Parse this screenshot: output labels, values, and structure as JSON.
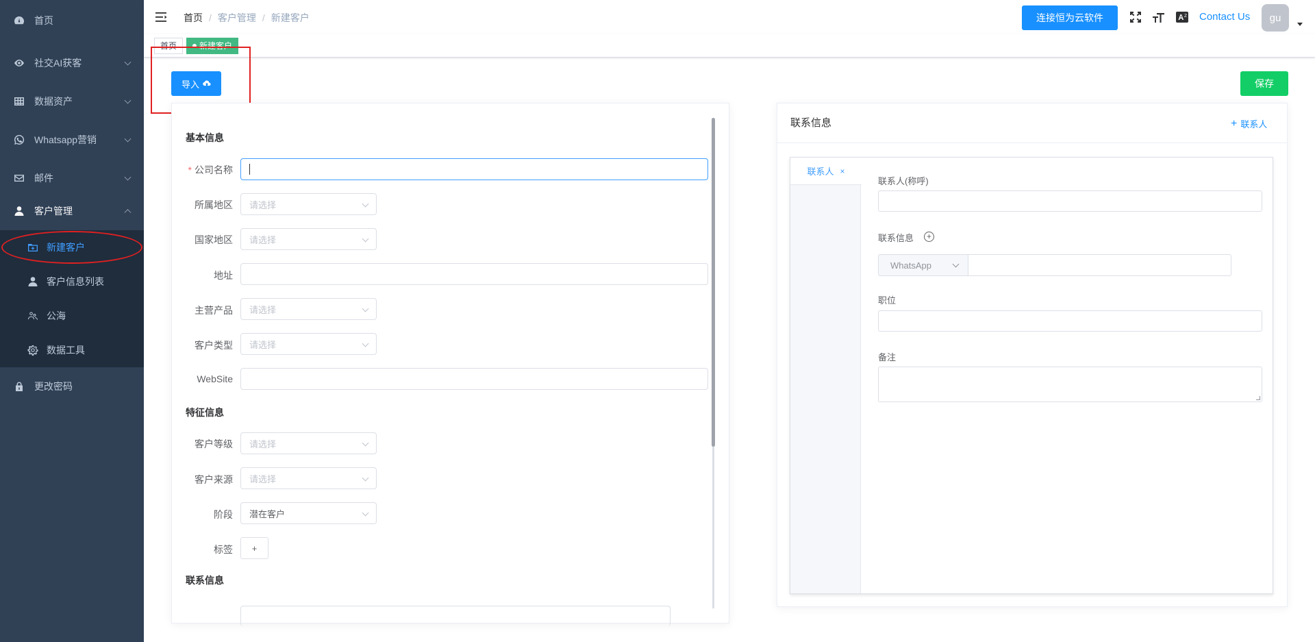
{
  "sidebar": {
    "items": [
      {
        "label": "首页",
        "icon": "dashboard-icon"
      },
      {
        "label": "社交AI获客",
        "icon": "eye-icon"
      },
      {
        "label": "数据资产",
        "icon": "table-icon"
      },
      {
        "label": "Whatsapp营销",
        "icon": "whatsapp-icon"
      },
      {
        "label": "邮件",
        "icon": "mail-icon"
      },
      {
        "label": "客户管理",
        "icon": "user-icon"
      }
    ],
    "sub_items": [
      {
        "label": "新建客户",
        "icon": "folder-add-icon"
      },
      {
        "label": "客户信息列表",
        "icon": "user-icon"
      },
      {
        "label": "公海",
        "icon": "users-icon"
      },
      {
        "label": "数据工具",
        "icon": "gear-icon"
      }
    ],
    "bottom": {
      "label": "更改密码",
      "icon": "lock-icon"
    }
  },
  "navbar": {
    "breadcrumb": [
      "首页",
      "客户管理",
      "新建客户"
    ],
    "connect_button": "连接恒为云软件",
    "contact_us": "Contact Us",
    "avatar_text": "gu"
  },
  "tags": {
    "home": "首页",
    "current": "新建客户"
  },
  "toolbar": {
    "import_label": "导入",
    "save_label": "保存"
  },
  "form": {
    "basic_title": "基本信息",
    "feature_title": "特征信息",
    "contact_title": "联系信息",
    "company_name_label": "公司名称",
    "region_label": "所属地区",
    "country_label": "国家地区",
    "address_label": "地址",
    "main_product_label": "主营产品",
    "customer_type_label": "客户类型",
    "website_label": "WebSite",
    "level_label": "客户等级",
    "source_label": "客户来源",
    "stage_label": "阶段",
    "tags_label": "标签",
    "placeholder_select": "请选择",
    "stage_value": "潜在客户",
    "tag_add": "+"
  },
  "contact_panel": {
    "title": "联系信息",
    "add_contact": "联系人",
    "tab_label": "联系人",
    "name_label": "联系人(称呼)",
    "info_label": "联系信息",
    "channel_value": "WhatsApp",
    "position_label": "职位",
    "remark_label": "备注"
  },
  "colors": {
    "sidebar_bg": "#304156",
    "submenu_bg": "#1f2d3d",
    "primary": "#1890ff",
    "success": "#13ce66",
    "tag_active": "#42b983",
    "annotation_red": "#e02020"
  }
}
